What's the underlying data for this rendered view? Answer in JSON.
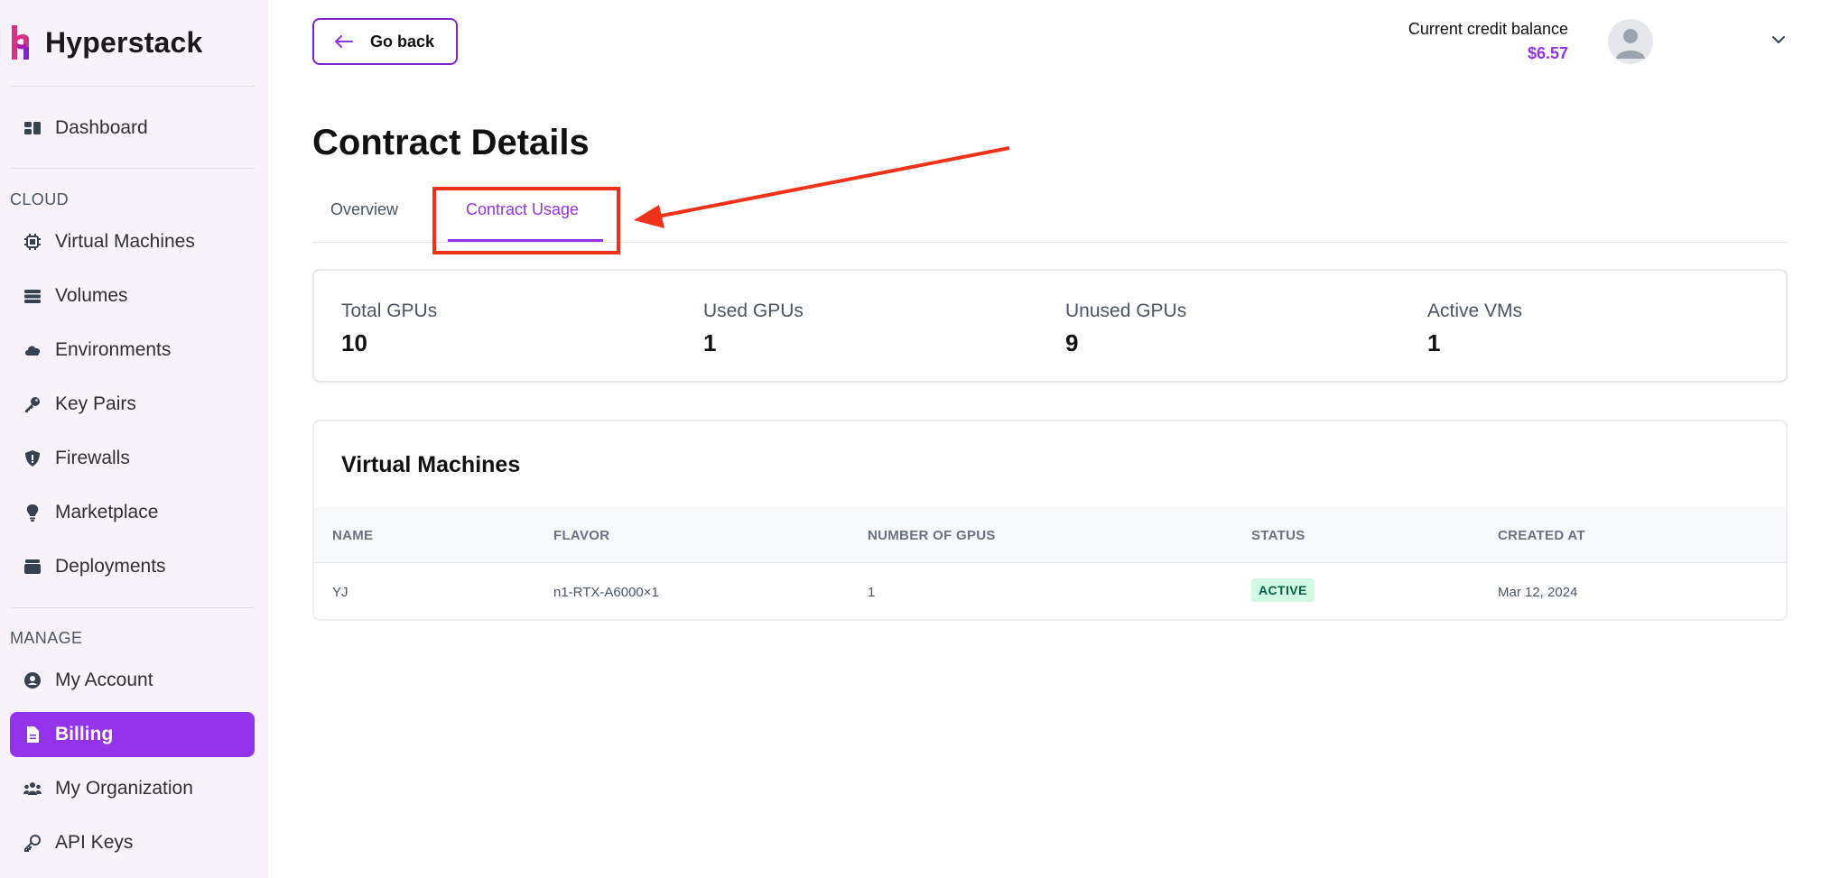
{
  "app": {
    "name": "Hyperstack"
  },
  "sidebar": {
    "dashboard": "Dashboard",
    "cloud_label": "CLOUD",
    "cloud_items": [
      {
        "label": "Virtual Machines",
        "icon": "chip-icon"
      },
      {
        "label": "Volumes",
        "icon": "volumes-icon"
      },
      {
        "label": "Environments",
        "icon": "cloud-icon"
      },
      {
        "label": "Key Pairs",
        "icon": "key-icon"
      },
      {
        "label": "Firewalls",
        "icon": "shield-icon"
      },
      {
        "label": "Marketplace",
        "icon": "lightbulb-icon"
      },
      {
        "label": "Deployments",
        "icon": "box-icon"
      }
    ],
    "manage_label": "MANAGE",
    "manage_items": [
      {
        "label": "My Account",
        "icon": "user-circle-icon"
      },
      {
        "label": "Billing",
        "icon": "document-icon",
        "active": true
      },
      {
        "label": "My Organization",
        "icon": "users-icon"
      },
      {
        "label": "API Keys",
        "icon": "key-outline-icon"
      }
    ]
  },
  "header": {
    "go_back": "Go back",
    "credit_label": "Current credit balance",
    "credit_value": "$6.57"
  },
  "page": {
    "title": "Contract Details",
    "tabs": [
      {
        "label": "Overview"
      },
      {
        "label": "Contract Usage",
        "active": true
      }
    ]
  },
  "stats": [
    {
      "label": "Total GPUs",
      "value": "10"
    },
    {
      "label": "Used GPUs",
      "value": "1"
    },
    {
      "label": "Unused GPUs",
      "value": "9"
    },
    {
      "label": "Active VMs",
      "value": "1"
    }
  ],
  "vm_table": {
    "title": "Virtual Machines",
    "columns": [
      "NAME",
      "FLAVOR",
      "NUMBER OF GPUS",
      "STATUS",
      "CREATED AT"
    ],
    "rows": [
      {
        "name": "YJ",
        "flavor": "n1-RTX-A6000×1",
        "gpus": "1",
        "status": "ACTIVE",
        "created_at": "Mar 12, 2024"
      }
    ]
  },
  "colors": {
    "accent": "#9333ea",
    "sidebar_bg": "#f8f2fb",
    "annotation": "#f0321a",
    "status_active_bg": "#d1fae5",
    "status_active_text": "#065f46"
  }
}
